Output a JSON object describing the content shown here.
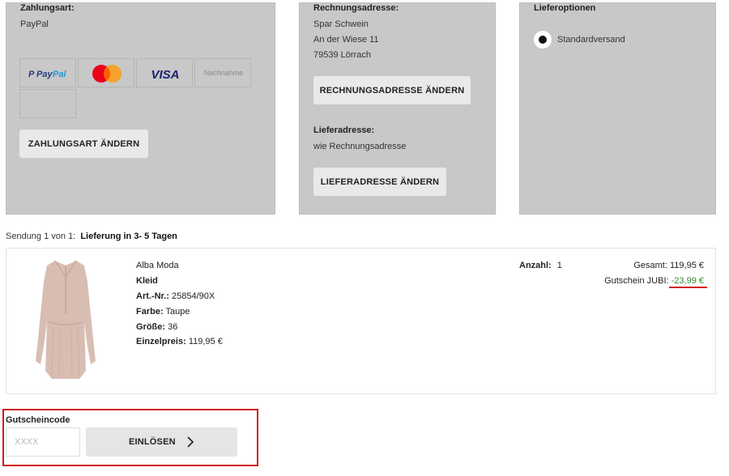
{
  "payment": {
    "title": "Zahlungsart:",
    "value": "PayPal",
    "methods": [
      "PayPal",
      "Mastercard",
      "VISA",
      "Nachnahme"
    ],
    "change_button": "ZAHLUNGSART ÄNDERN"
  },
  "billing": {
    "title": "Rechnungsadresse:",
    "name": "Spar Schwein",
    "street": "An der Wiese 11",
    "city": "79539 Lörrach",
    "change_button": "RECHNUNGSADRESSE ÄNDERN",
    "delivery_title": "Lieferadresse:",
    "delivery_value": "wie Rechnungsadresse",
    "delivery_button": "LIEFERADRESSE ÄNDERN"
  },
  "delivery_options": {
    "title": "Lieferoptionen",
    "option": "Standardversand",
    "selected": true
  },
  "shipment": {
    "prefix": "Sendung 1 von 1:",
    "label": "Lieferung in 3- 5 Tagen"
  },
  "product": {
    "brand": "Alba Moda",
    "name": "Kleid",
    "art_label": "Art.-Nr.:",
    "art_value": "25854/90X",
    "color_label": "Farbe:",
    "color_value": "Taupe",
    "size_label": "Größe:",
    "size_value": "36",
    "unit_price_label": "Einzelpreis:",
    "unit_price_value": "119,95 €",
    "qty_label": "Anzahl:",
    "qty_value": "1",
    "total_label": "Gesamt:",
    "total_value": "119,95 €",
    "voucher_label": "Gutschein JUBI:",
    "voucher_value": "-23,99 €"
  },
  "voucher": {
    "title": "Gutscheincode",
    "placeholder": "XXXX",
    "redeem_button": "EINLÖSEN"
  },
  "colors": {
    "panel_bg": "#c8c8c8",
    "discount_green": "#2e8b2e",
    "highlight_red": "#d11a1a",
    "paypal_blue": "#253b80",
    "paypal_light": "#179bd7",
    "visa_blue": "#1a1f71"
  }
}
